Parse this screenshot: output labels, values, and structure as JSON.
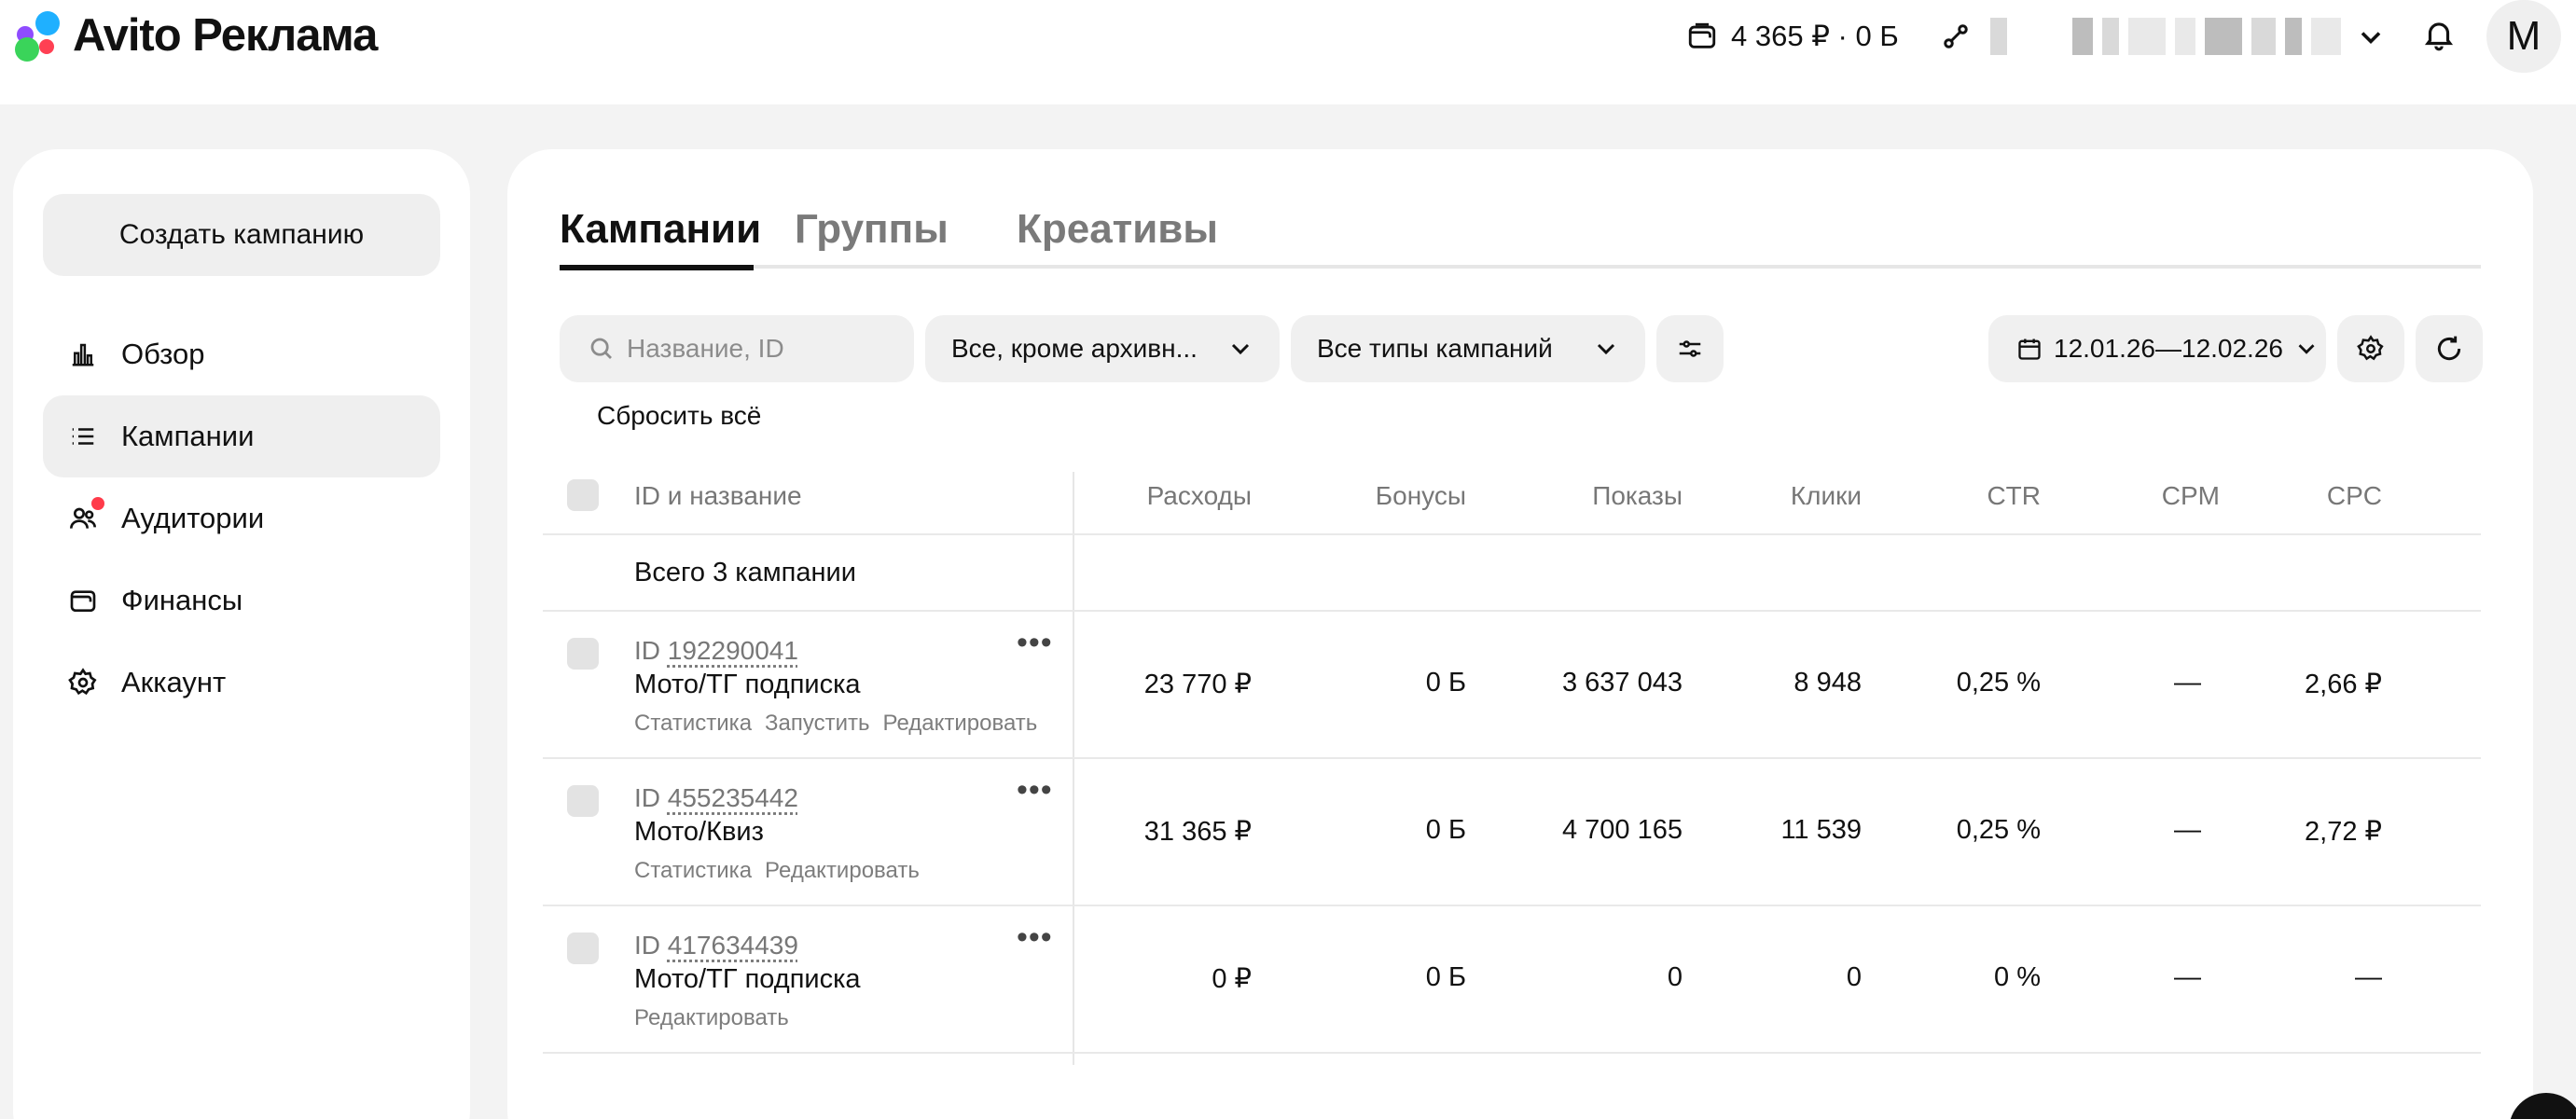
{
  "header": {
    "logo_text": "Avito Реклама",
    "balance": "4 365 ₽ · 0 Б",
    "avatar_letter": "M"
  },
  "sidebar": {
    "create_button": "Создать кампанию",
    "items": [
      {
        "label": "Обзор",
        "icon": "bar-chart-icon"
      },
      {
        "label": "Кампании",
        "icon": "list-icon",
        "active": true
      },
      {
        "label": "Аудитории",
        "icon": "people-icon",
        "badge": true
      },
      {
        "label": "Финансы",
        "icon": "wallet-icon"
      },
      {
        "label": "Аккаунт",
        "icon": "gear-icon"
      }
    ]
  },
  "tabs": [
    {
      "label": "Кампании",
      "active": true
    },
    {
      "label": "Группы"
    },
    {
      "label": "Креативы"
    }
  ],
  "filters": {
    "search_placeholder": "Название, ID",
    "status_select": "Все, кроме архивн...",
    "type_select": "Все типы кампаний",
    "date_range": "12.01.26—12.02.26",
    "reset_label": "Сбросить всё"
  },
  "table": {
    "columns": {
      "name": "ID и название",
      "spend": "Расходы",
      "bonus": "Бонусы",
      "impressions": "Показы",
      "clicks": "Клики",
      "ctr": "CTR",
      "cpm": "CPM",
      "cpc": "CPC"
    },
    "total_label": "Всего 3 кампании",
    "rows": [
      {
        "id_prefix": "ID",
        "id": "192290041",
        "name": "Мото/ТГ подписка",
        "actions": [
          "Статистика",
          "Запустить",
          "Редактировать"
        ],
        "spend": "23 770 ₽",
        "bonus": "0 Б",
        "impressions": "3 637 043",
        "clicks": "8 948",
        "ctr": "0,25 %",
        "cpm": "—",
        "cpc": "2,66 ₽"
      },
      {
        "id_prefix": "ID",
        "id": "455235442",
        "name": "Мото/Квиз",
        "actions": [
          "Статистика",
          "Редактировать"
        ],
        "spend": "31 365 ₽",
        "bonus": "0 Б",
        "impressions": "4 700 165",
        "clicks": "11 539",
        "ctr": "0,25 %",
        "cpm": "—",
        "cpc": "2,72 ₽"
      },
      {
        "id_prefix": "ID",
        "id": "417634439",
        "name": "Мото/ТГ подписка",
        "actions": [
          "Редактировать"
        ],
        "spend": "0 ₽",
        "bonus": "0 Б",
        "impressions": "0",
        "clicks": "0",
        "ctr": "0 %",
        "cpm": "—",
        "cpc": "—"
      }
    ]
  },
  "colors": {
    "page_bg": "#f3f3f3",
    "accent_red": "#ff3b4a",
    "logo_green": "#3ad45a",
    "logo_blue": "#1fb0ff",
    "logo_purple": "#8f4cff",
    "logo_red": "#ff4053"
  }
}
